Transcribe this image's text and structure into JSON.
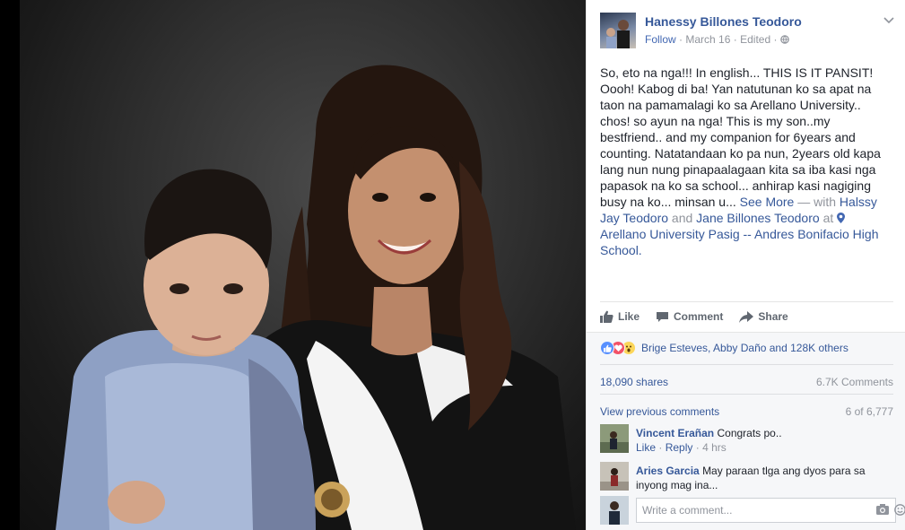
{
  "post": {
    "author": "Hanessy Billones Teodoro",
    "follow_label": "Follow",
    "date": "March 16",
    "edited_label": "Edited",
    "body_text": "So, eto na nga!!! In english... THIS IS IT PANSIT! Oooh! Kabog di ba! Yan natutunan ko sa apat na taon na pamamalagi ko sa Arellano University.. chos! so ayun na nga! This is my son..my bestfriend.. and my companion for 6years and counting. Natatandaan ko pa nun, 2years old kapa lang nun nung pinapaalagaan kita sa iba kasi nga papasok na ko sa school... anhirap kasi nagiging busy na ko... minsan u...",
    "see_more_label": "See More",
    "with_label": "— with",
    "tag_1": "Halssy Jay Teodoro",
    "and_label": "and",
    "tag_2": "Jane Billones Teodoro",
    "at_label": "at",
    "location": "Arellano University Pasig -- Andres Bonifacio High School."
  },
  "actions": {
    "like_label": "Like",
    "comment_label": "Comment",
    "share_label": "Share"
  },
  "summary": {
    "reactors_text": "Brige Esteves, Abby Daño and 128K others",
    "shares_text": "18,090 shares",
    "comments_text": "6.7K Comments",
    "view_previous_label": "View previous comments",
    "pager_text": "6 of 6,777"
  },
  "comments": [
    {
      "name": "Vincent Erañan",
      "text": "Congrats po..",
      "like_label": "Like",
      "reply_label": "Reply",
      "time": "4 hrs"
    },
    {
      "name": "Aries Garcia",
      "text": "May paraan tlga ang dyos para sa inyong mag ina..."
    }
  ],
  "composer": {
    "placeholder": "Write a comment..."
  },
  "icons": {
    "globe": "globe-icon",
    "chevron": "chevron-down-icon",
    "location": "location-pin-icon",
    "camera": "camera-icon",
    "emoji": "emoji-icon"
  },
  "colors": {
    "link": "#365899",
    "follow": "#4267b2",
    "muted": "#90949c",
    "like_reaction": "#5890ff",
    "love_reaction": "#f25268",
    "wow_reaction": "#fcd659"
  }
}
